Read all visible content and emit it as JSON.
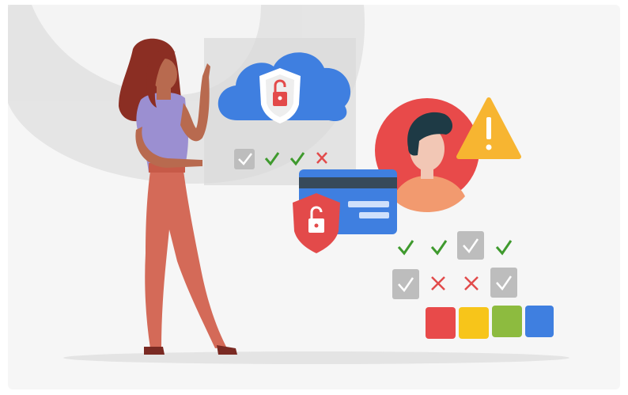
{
  "colors": {
    "background": "#ffffff",
    "card": "#f6f6f6",
    "cloud": "#3f7fe0",
    "shield": "#e34a4a",
    "lock": "#e34a4a",
    "check_green": "#3f9a2e",
    "cross_red": "#e24b4b",
    "gray_box": "#bdbdbd",
    "warning": "#f7b531",
    "avatar_bg": "#e84a4a",
    "swatches": [
      "#e84a4a",
      "#f7c51a",
      "#8dbb3f",
      "#3f7fe0"
    ]
  },
  "cloud_panel": {
    "statuses": [
      "check-box-icon",
      "check-icon",
      "check-icon",
      "cross-icon"
    ]
  },
  "status_grid": {
    "row1": [
      "check-icon",
      "check-icon",
      "check-box-icon",
      "check-icon"
    ],
    "row2": [
      "check-box-icon",
      "cross-icon",
      "cross-icon",
      "check-box-icon"
    ]
  },
  "swatch_row": [
    "red",
    "yellow",
    "green",
    "blue"
  ]
}
